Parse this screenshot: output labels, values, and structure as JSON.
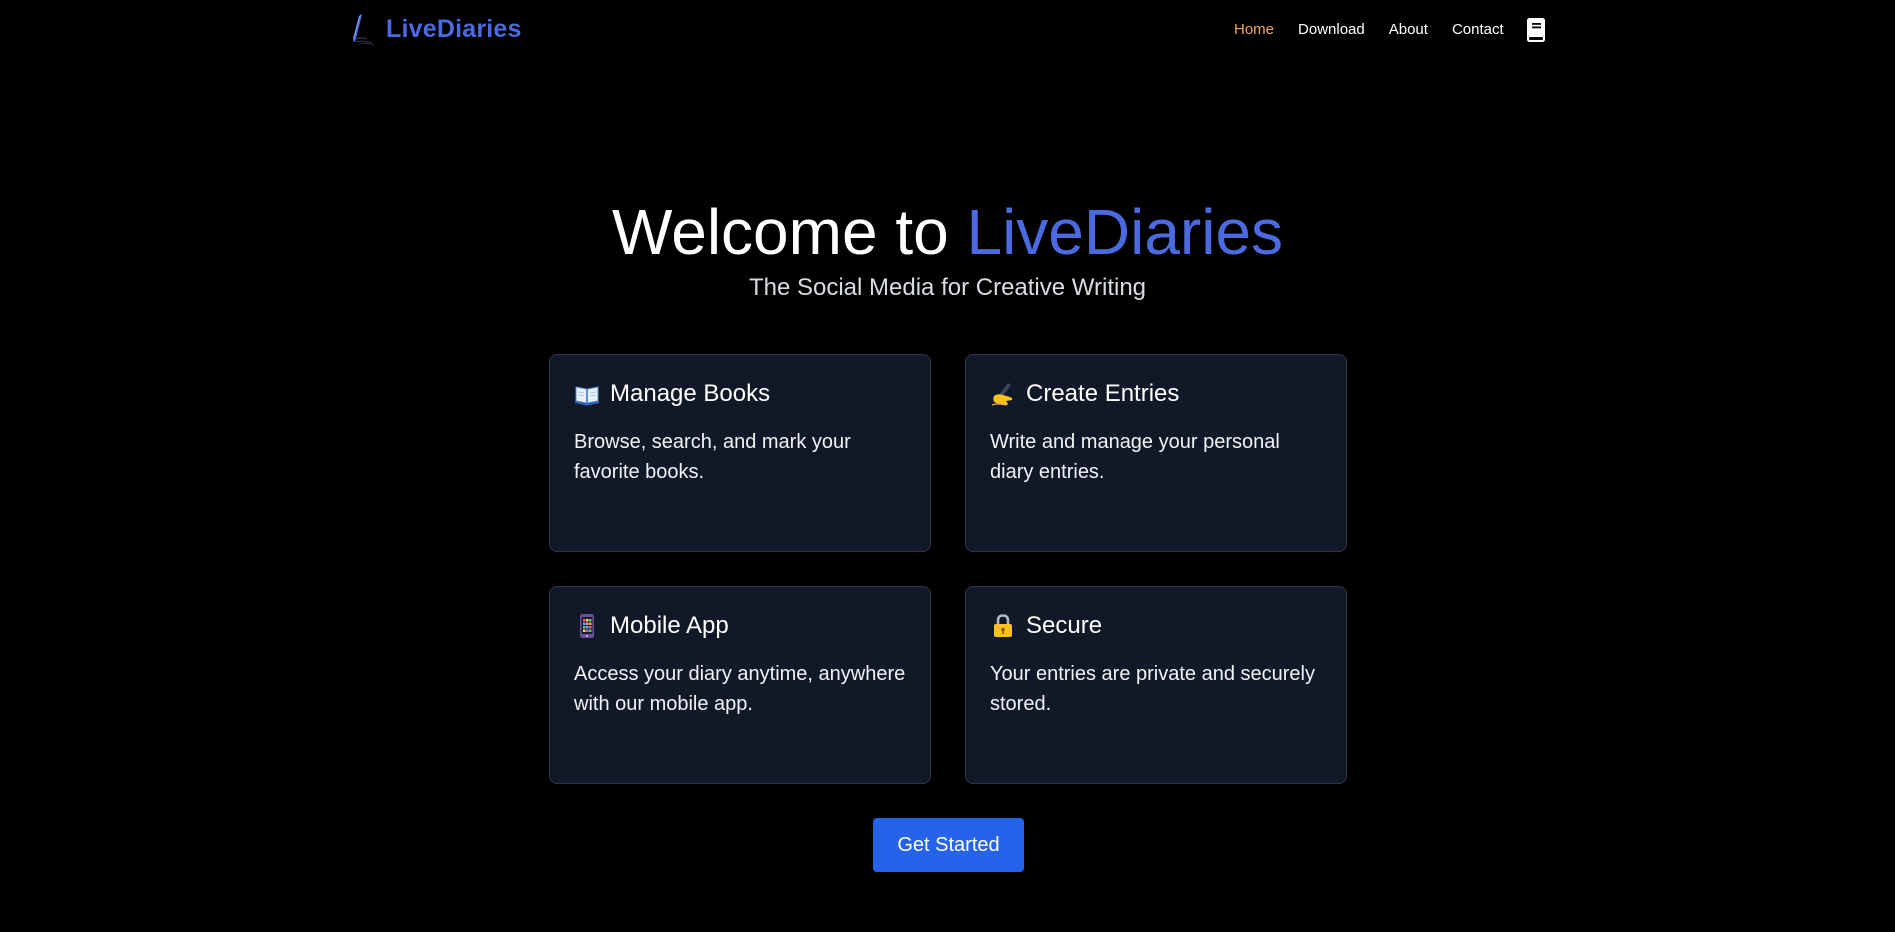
{
  "nav": {
    "brand": "LiveDiaries",
    "links": [
      {
        "label": "Home",
        "active": true
      },
      {
        "label": "Download",
        "active": false
      },
      {
        "label": "About",
        "active": false
      },
      {
        "label": "Contact",
        "active": false
      }
    ],
    "book_icon": "book-icon"
  },
  "hero": {
    "title_prefix": "Welcome to",
    "title_accent": "LiveDiaries",
    "subtitle": "The Social Media for Creative Writing"
  },
  "features": [
    {
      "icon": "open-book-icon",
      "title": "Manage Books",
      "desc": "Browse, search, and mark your favorite books."
    },
    {
      "icon": "writing-hand-icon",
      "title": "Create Entries",
      "desc": "Write and manage your personal diary entries."
    },
    {
      "icon": "mobile-phone-icon",
      "title": "Mobile App",
      "desc": "Access your diary anytime, anywhere with our mobile app."
    },
    {
      "icon": "lock-icon",
      "title": "Secure",
      "desc": "Your entries are private and securely stored."
    }
  ],
  "cta": {
    "label": "Get Started"
  },
  "colors": {
    "accent": "#4b6ae0",
    "active_nav": "#f4a261",
    "card_bg": "#111827",
    "button": "#2563eb",
    "background": "#000000"
  }
}
